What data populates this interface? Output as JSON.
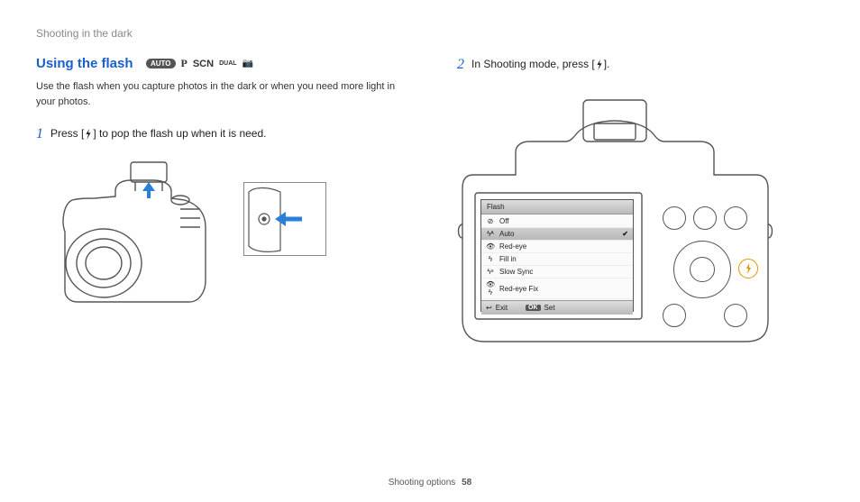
{
  "breadcrumb": "Shooting in the dark",
  "section": {
    "title": "Using the flash",
    "modes": {
      "auto": "AUTO",
      "p": "P",
      "scn": "SCN",
      "dual": "DUAL",
      "cam": "📷"
    },
    "intro": "Use the flash when you capture photos in the dark or when you need more light in your photos."
  },
  "steps": {
    "s1": {
      "num": "1",
      "pre": "Press [",
      "post": "] to pop the flash up when it is need."
    },
    "s2": {
      "num": "2",
      "pre": "In Shooting mode, press [",
      "post": "]."
    }
  },
  "lcd": {
    "title": "Flash",
    "items": [
      {
        "icon": "⊘",
        "label": "Off",
        "selected": false
      },
      {
        "icon": "ϟᴬ",
        "label": "Auto",
        "selected": true
      },
      {
        "icon": "👁",
        "label": "Red-eye",
        "selected": false
      },
      {
        "icon": "ϟ",
        "label": "Fill in",
        "selected": false
      },
      {
        "icon": "ϟˢ",
        "label": "Slow Sync",
        "selected": false
      },
      {
        "icon": "👁ϟ",
        "label": "Red-eye Fix",
        "selected": false
      }
    ],
    "footer": {
      "exit_icon": "↩",
      "exit": "Exit",
      "set_btn": "OK",
      "set": "Set"
    }
  },
  "footer": {
    "section": "Shooting options",
    "page": "58"
  }
}
